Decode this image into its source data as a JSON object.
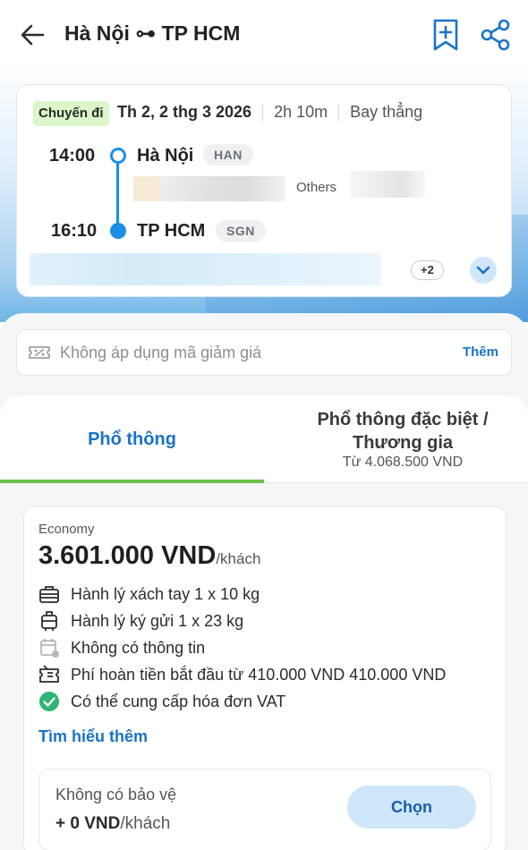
{
  "header": {
    "title": "Hà Nội ⊶ TP HCM"
  },
  "flight": {
    "chip": "Chuyến đi",
    "date": "Th 2, 2 thg 3 2026",
    "duration": "2h 10m",
    "type": "Bay thẳng",
    "departure": {
      "time": "14:00",
      "city": "Hà Nội",
      "code": "HAN"
    },
    "arrival": {
      "time": "16:10",
      "city": "TP HCM",
      "code": "SGN"
    },
    "others_label": "Others",
    "more_count": "+2"
  },
  "promo": {
    "text": "Không áp dụng mã giảm giá",
    "action": "Thêm"
  },
  "tabs": {
    "economy": "Phổ thông",
    "premium": "Phổ thông đặc biệt / Thương gia",
    "premium_sub": "Từ 4.068.500 VND"
  },
  "fare": {
    "class": "Economy",
    "price": "3.601.000 VND",
    "per": "/khách",
    "features": [
      {
        "icon": "carry-on-bag-icon",
        "text": "Hành lý xách tay 1 x 10 kg"
      },
      {
        "icon": "checked-luggage-icon",
        "text": "Hành lý ký gửi 1 x 23 kg"
      },
      {
        "icon": "calendar-icon",
        "text": "Không có thông tin"
      },
      {
        "icon": "refund-ticket-icon",
        "text": "Phí hoàn tiền bắt đầu từ 410.000 VND 410.000 VND"
      },
      {
        "icon": "check-circle-icon",
        "text": "Có thể cung cấp hóa đơn VAT"
      }
    ],
    "learn_more": "Tìm hiểu thêm",
    "protection": {
      "name": "Không có bảo vệ",
      "price": "+ 0 VND",
      "per": "/khách",
      "button": "Chọn"
    }
  },
  "colors": {
    "accent": "#1a8fe8",
    "link": "#1a73c8",
    "tab_underline": "#6cc24a",
    "chip_bg": "#dcf5c9",
    "check_green": "#2bb673"
  }
}
